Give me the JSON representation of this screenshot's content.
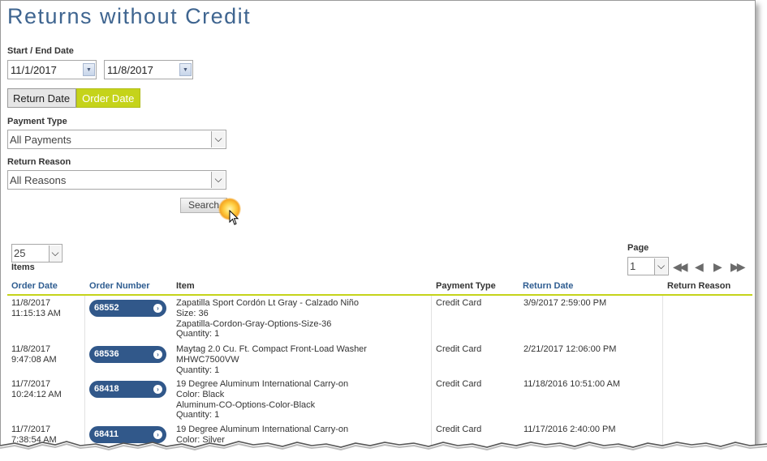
{
  "page": {
    "title": "Returns without Credit"
  },
  "filters": {
    "date_label": "Start / End Date",
    "start_date": "11/1/2017",
    "end_date": "11/8/2017",
    "date_toggle": {
      "return_label": "Return Date",
      "order_label": "Order Date",
      "selected": "Order Date"
    },
    "payment_type_label": "Payment Type",
    "payment_type_value": "All Payments",
    "return_reason_label": "Return Reason",
    "return_reason_value": "All Reasons",
    "search_label": "Search"
  },
  "paging": {
    "page_size": "25",
    "items_label": "Items",
    "page_label": "Page",
    "page_value": "1",
    "nav_icons": [
      "first-page-icon",
      "previous-page-icon",
      "next-page-icon",
      "last-page-icon"
    ]
  },
  "table": {
    "columns": [
      "Order Date",
      "Order Number",
      "Item",
      "Payment Type",
      "Return Date",
      "Return Reason"
    ],
    "rows": [
      {
        "order_date": "11/8/2017",
        "order_time": "11:15:13 AM",
        "order_number": "68552",
        "item_lines": [
          "Zapatilla Sport Cordón Lt Gray - Calzado Niño",
          "Size: 36",
          "Zapatilla-Cordon-Gray-Options-Size-36",
          "Quantity: 1"
        ],
        "payment_type": "Credit Card",
        "return_date": "3/9/2017 2:59:00 PM",
        "return_reason": ""
      },
      {
        "order_date": "11/8/2017",
        "order_time": "9:47:08 AM",
        "order_number": "68536",
        "item_lines": [
          "Maytag 2.0 Cu. Ft. Compact Front-Load Washer",
          "MHWC7500VW",
          "Quantity: 1"
        ],
        "payment_type": "Credit Card",
        "return_date": "2/21/2017 12:06:00 PM",
        "return_reason": ""
      },
      {
        "order_date": "11/7/2017",
        "order_time": "10:24:12 AM",
        "order_number": "68418",
        "item_lines": [
          "19 Degree Aluminum International Carry-on",
          "Color: Black",
          "Aluminum-CO-Options-Color-Black",
          "Quantity: 1"
        ],
        "payment_type": "Credit Card",
        "return_date": "11/18/2016 10:51:00 AM",
        "return_reason": ""
      },
      {
        "order_date": "11/7/2017",
        "order_time": "7:38:54 AM",
        "order_number": "68411",
        "item_lines": [
          "19 Degree Aluminum International Carry-on",
          "Color: Silver"
        ],
        "payment_type": "Credit Card",
        "return_date": "11/17/2016 2:40:00 PM",
        "return_reason": ""
      }
    ]
  },
  "colors": {
    "title": "#3f6590",
    "accent": "#c5d31a",
    "link": "#2f5d91",
    "pill": "#31588a"
  }
}
